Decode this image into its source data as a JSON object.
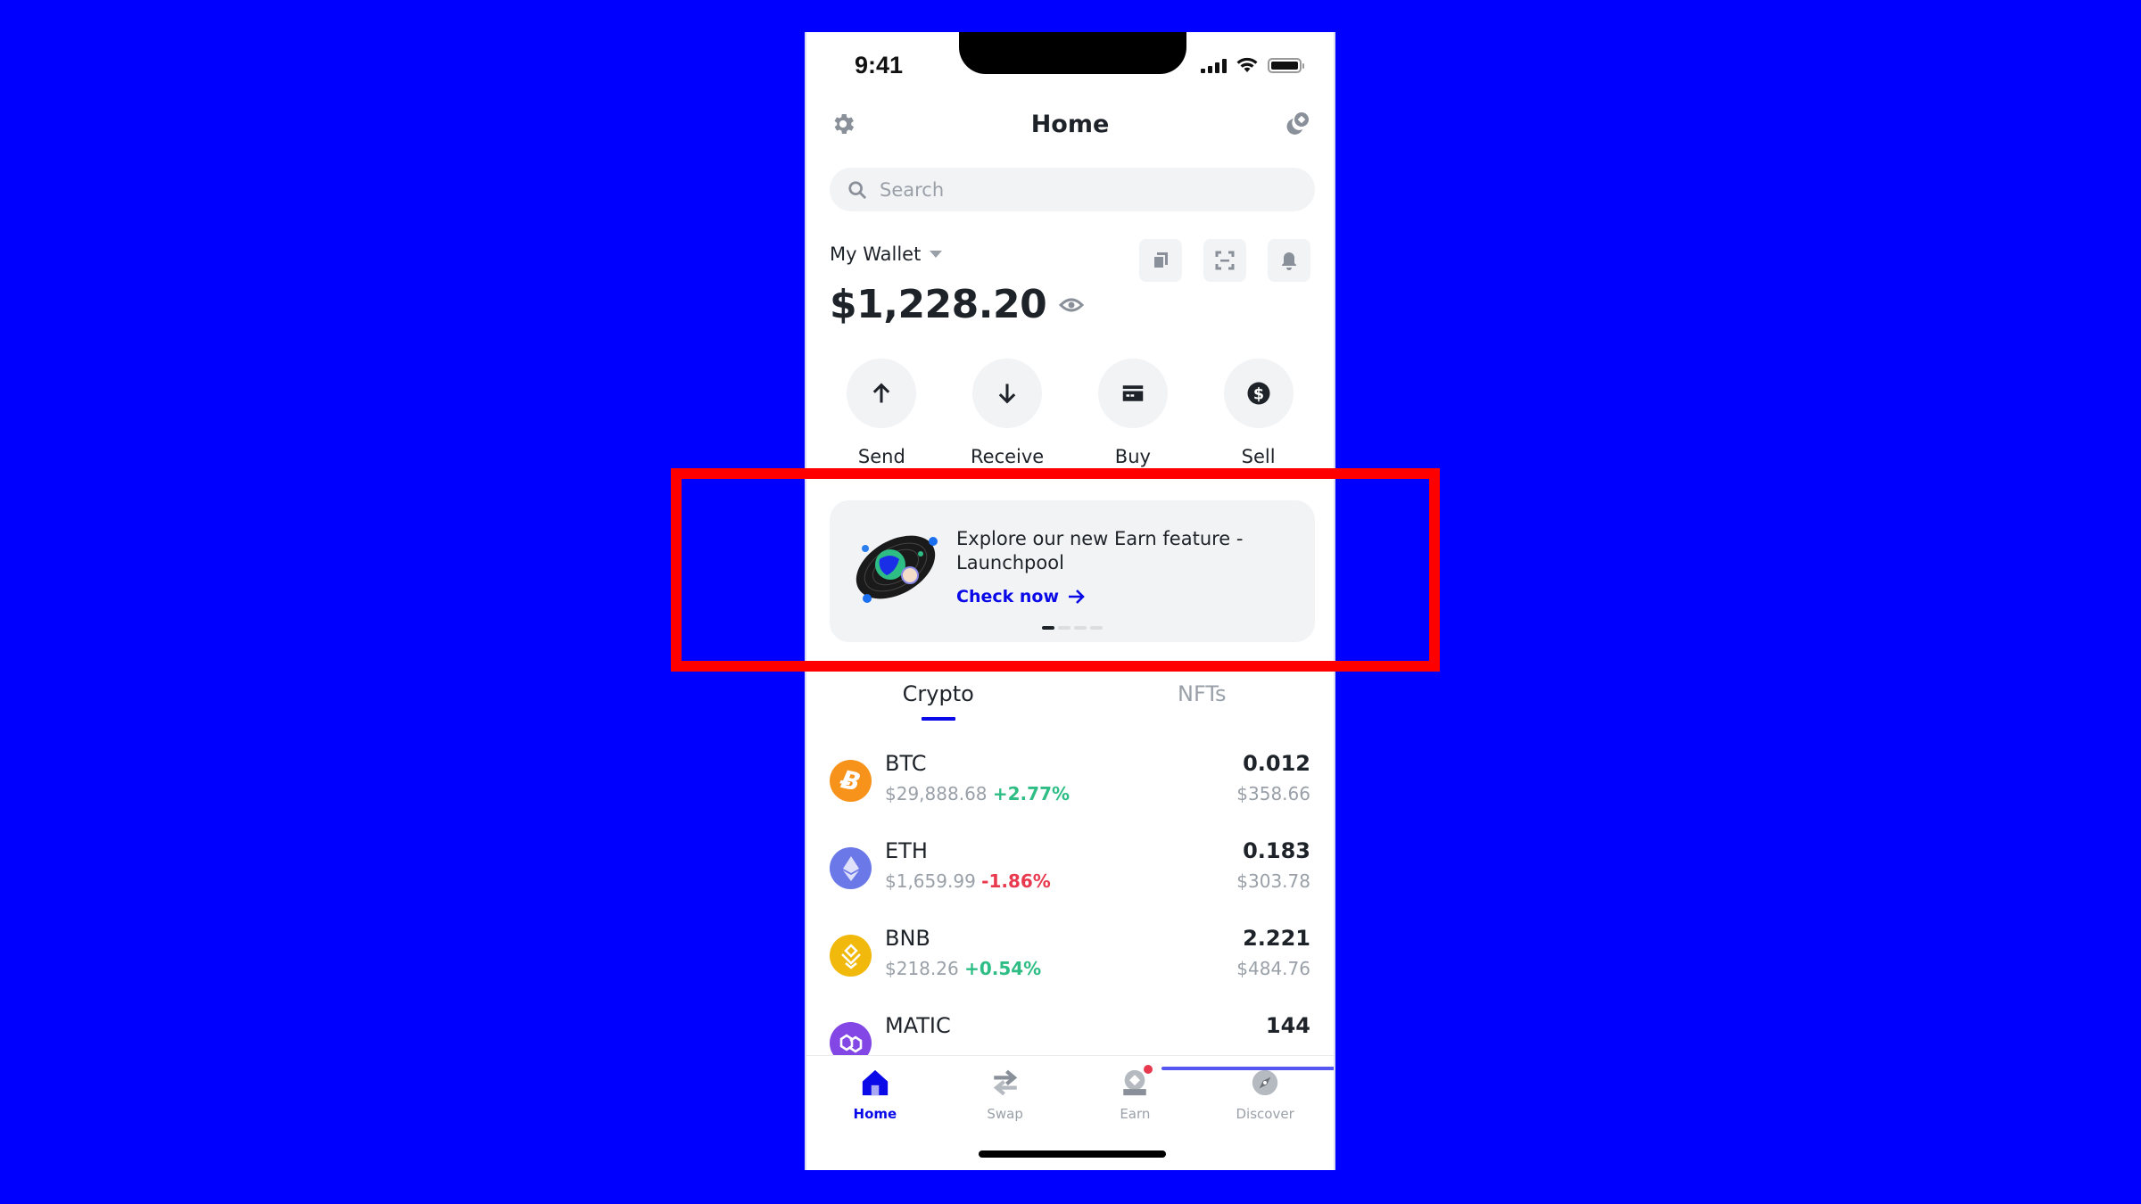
{
  "status_bar": {
    "time": "9:41"
  },
  "header": {
    "title": "Home",
    "settings_icon": "gear-icon",
    "connect_icon": "walletconnect-icon"
  },
  "search": {
    "placeholder": "Search",
    "value": ""
  },
  "wallet": {
    "name": "My Wallet",
    "balance": "$1,228.20",
    "actions": [
      {
        "icon": "copy-icon"
      },
      {
        "icon": "scan-icon"
      },
      {
        "icon": "bell-icon"
      }
    ]
  },
  "quick_actions": [
    {
      "label": "Send",
      "icon": "arrow-up-icon"
    },
    {
      "label": "Receive",
      "icon": "arrow-down-icon"
    },
    {
      "label": "Buy",
      "icon": "card-icon"
    },
    {
      "label": "Sell",
      "icon": "dollar-icon"
    }
  ],
  "banner": {
    "text": "Explore our new Earn feature - Launchpool",
    "cta": "Check now",
    "page_count": 4,
    "active_page": 1
  },
  "tabs": [
    {
      "label": "Crypto",
      "active": true
    },
    {
      "label": "NFTs",
      "active": false
    }
  ],
  "coins": [
    {
      "symbol": "BTC",
      "price": "$29,888.68",
      "change": "+2.77%",
      "direction": "up",
      "quantity": "0.012",
      "value": "$358.66",
      "color": "#f7931a"
    },
    {
      "symbol": "ETH",
      "price": "$1,659.99",
      "change": "-1.86%",
      "direction": "down",
      "quantity": "0.183",
      "value": "$303.78",
      "color": "#6b78e8"
    },
    {
      "symbol": "BNB",
      "price": "$218.26",
      "change": "+0.54%",
      "direction": "up",
      "quantity": "2.221",
      "value": "$484.76",
      "color": "#f0b90b"
    },
    {
      "symbol": "MATIC",
      "price": "",
      "change": "",
      "direction": "up",
      "quantity": "144",
      "value": "",
      "color": "#8247e5"
    }
  ],
  "bottom_nav": [
    {
      "label": "Home",
      "icon": "home-icon",
      "active": true
    },
    {
      "label": "Swap",
      "icon": "swap-icon",
      "active": false
    },
    {
      "label": "Earn",
      "icon": "earn-icon",
      "active": false,
      "badge": true
    },
    {
      "label": "Discover",
      "icon": "compass-icon",
      "active": false
    }
  ],
  "colors": {
    "accent": "#0a0ae8",
    "up": "#2ebd85",
    "down": "#e8394e",
    "background": "#0000fe",
    "highlight": "#fe0000"
  }
}
